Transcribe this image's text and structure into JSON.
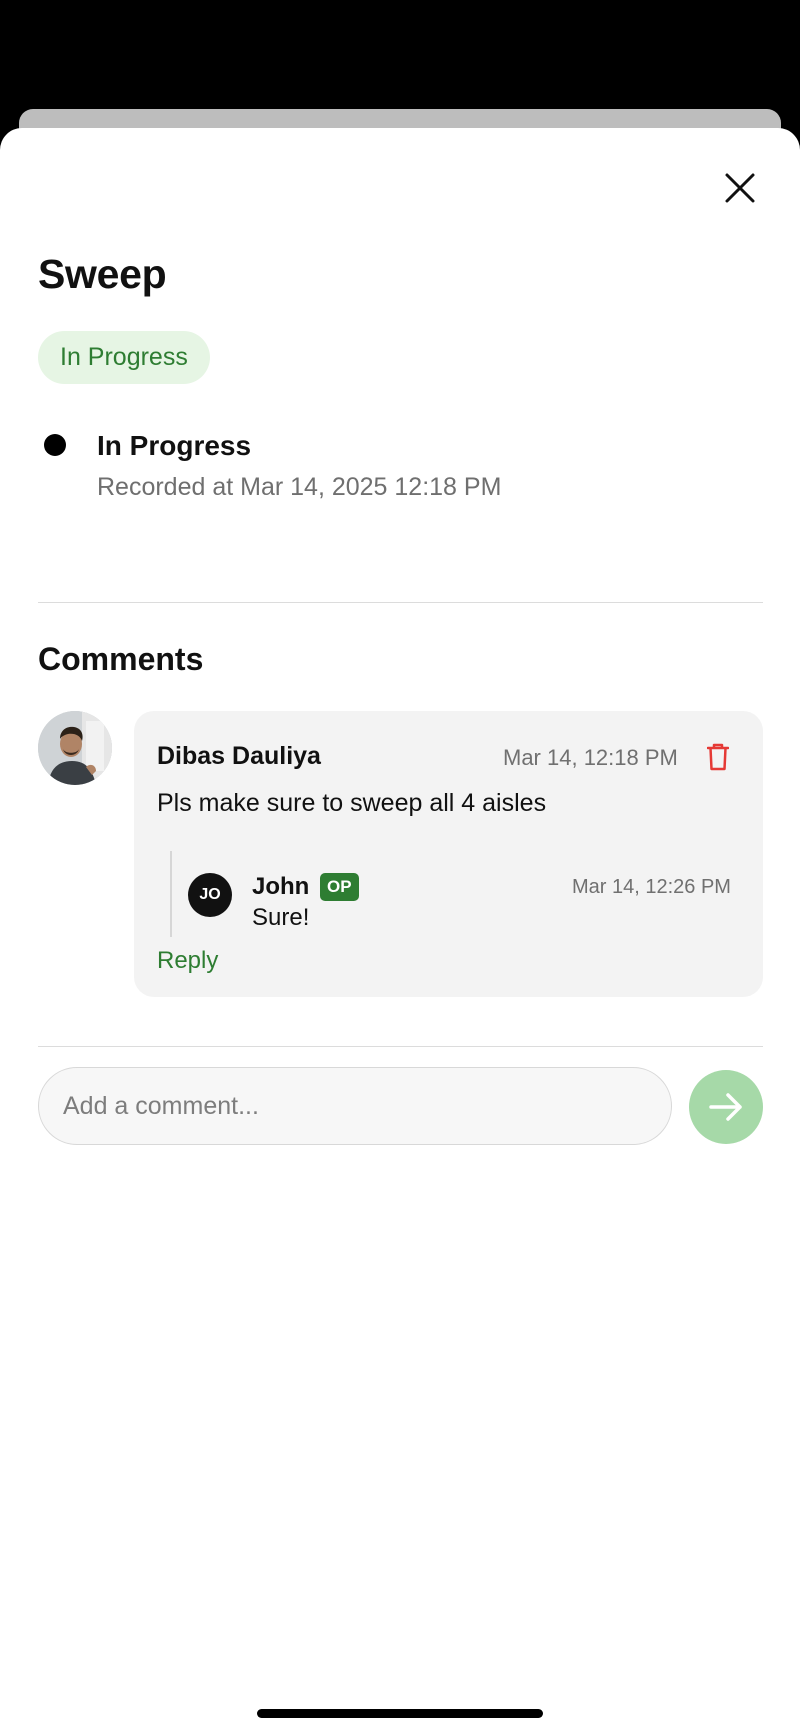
{
  "task": {
    "title": "Sweep",
    "status_pill": "In Progress"
  },
  "timeline": [
    {
      "status": "In Progress",
      "recorded": "Recorded at Mar 14, 2025 12:18 PM"
    }
  ],
  "comments_section": {
    "title": "Comments",
    "comments": [
      {
        "author": "Dibas Dauliya",
        "time": "Mar 14, 12:18 PM",
        "body": "Pls make sure to sweep all 4 aisles",
        "replies": [
          {
            "initials": "JO",
            "author": "John",
            "badge": "OP",
            "time": "Mar 14, 12:26 PM",
            "body": "Sure!"
          }
        ],
        "reply_label": "Reply"
      }
    ]
  },
  "composer": {
    "placeholder": "Add a comment..."
  },
  "icons": {
    "close": "close-icon",
    "trash": "trash-icon",
    "send": "arrow-right-icon"
  },
  "colors": {
    "accent_green": "#2e7d32",
    "pill_background": "#e6f5e4",
    "send_button": "#a6d9a8",
    "delete_red": "#e53935"
  }
}
